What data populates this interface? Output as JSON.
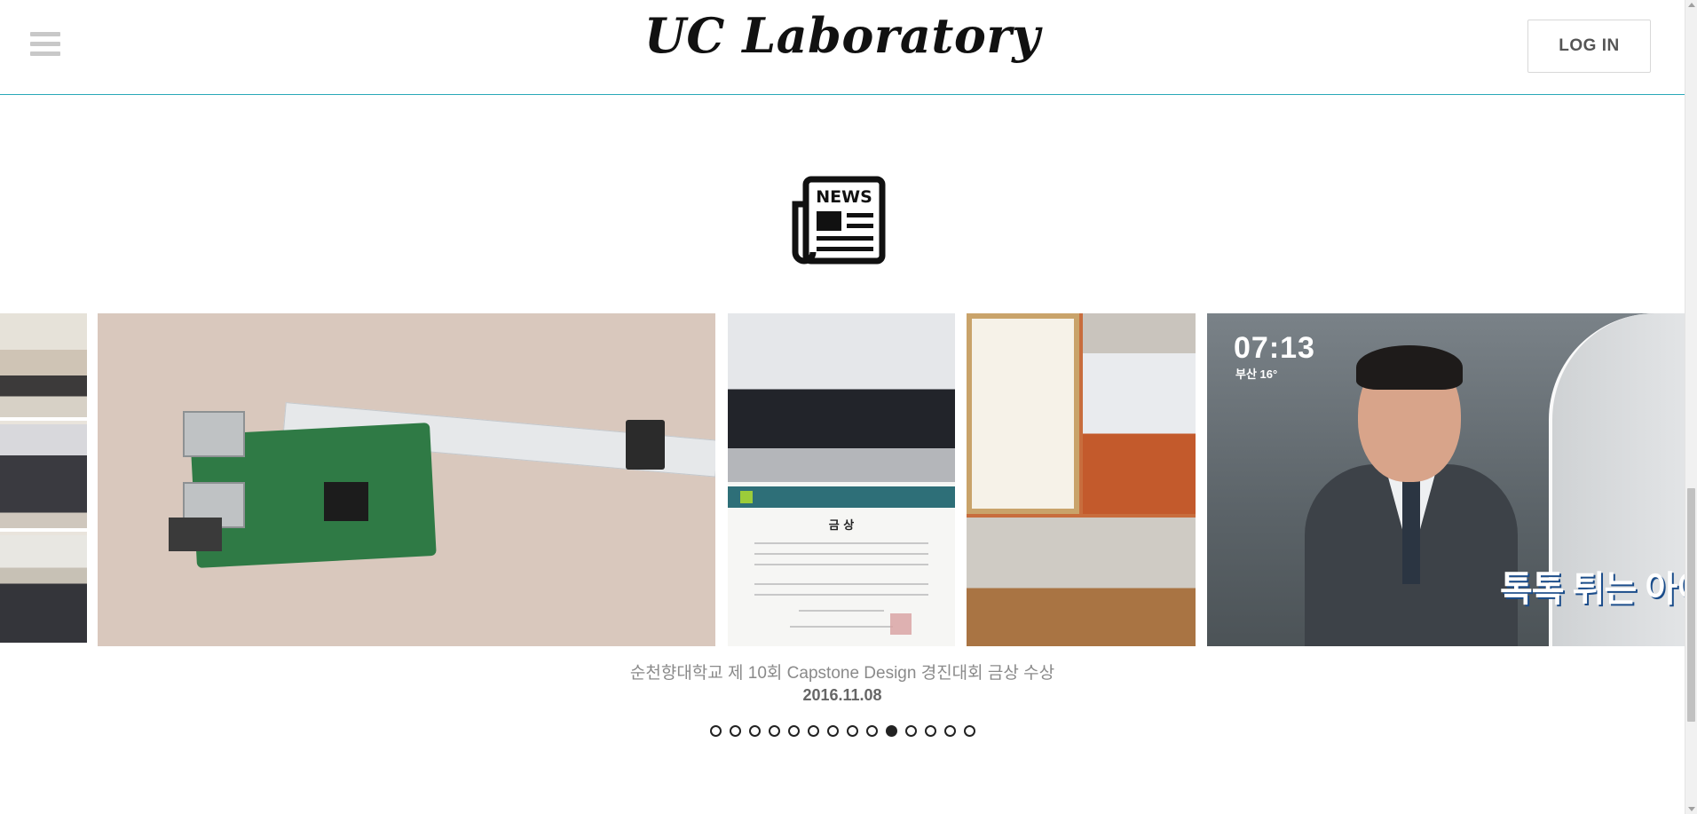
{
  "header": {
    "brand": "UC Laboratory",
    "login_label": "LOG IN"
  },
  "news": {
    "icon_label": "NEWS"
  },
  "carousel": {
    "slides": [
      {
        "name": "ceremony-collage"
      },
      {
        "name": "raspberry-pi-camera"
      },
      {
        "name": "capstone-certificate",
        "certificate_title": "금    상"
      },
      {
        "name": "award-collage"
      },
      {
        "name": "news-broadcast",
        "time": "07:13",
        "weather": "부산 16°",
        "caption": "톡톡 튀는 아이디"
      }
    ],
    "caption": "순천향대학교 제 10회 Capstone Design 경진대회 금상 수상",
    "date": "2016.11.08",
    "dot_count": 14,
    "active_index": 9
  },
  "colors": {
    "header_border": "#2aa8b8",
    "dot": "#222222"
  }
}
